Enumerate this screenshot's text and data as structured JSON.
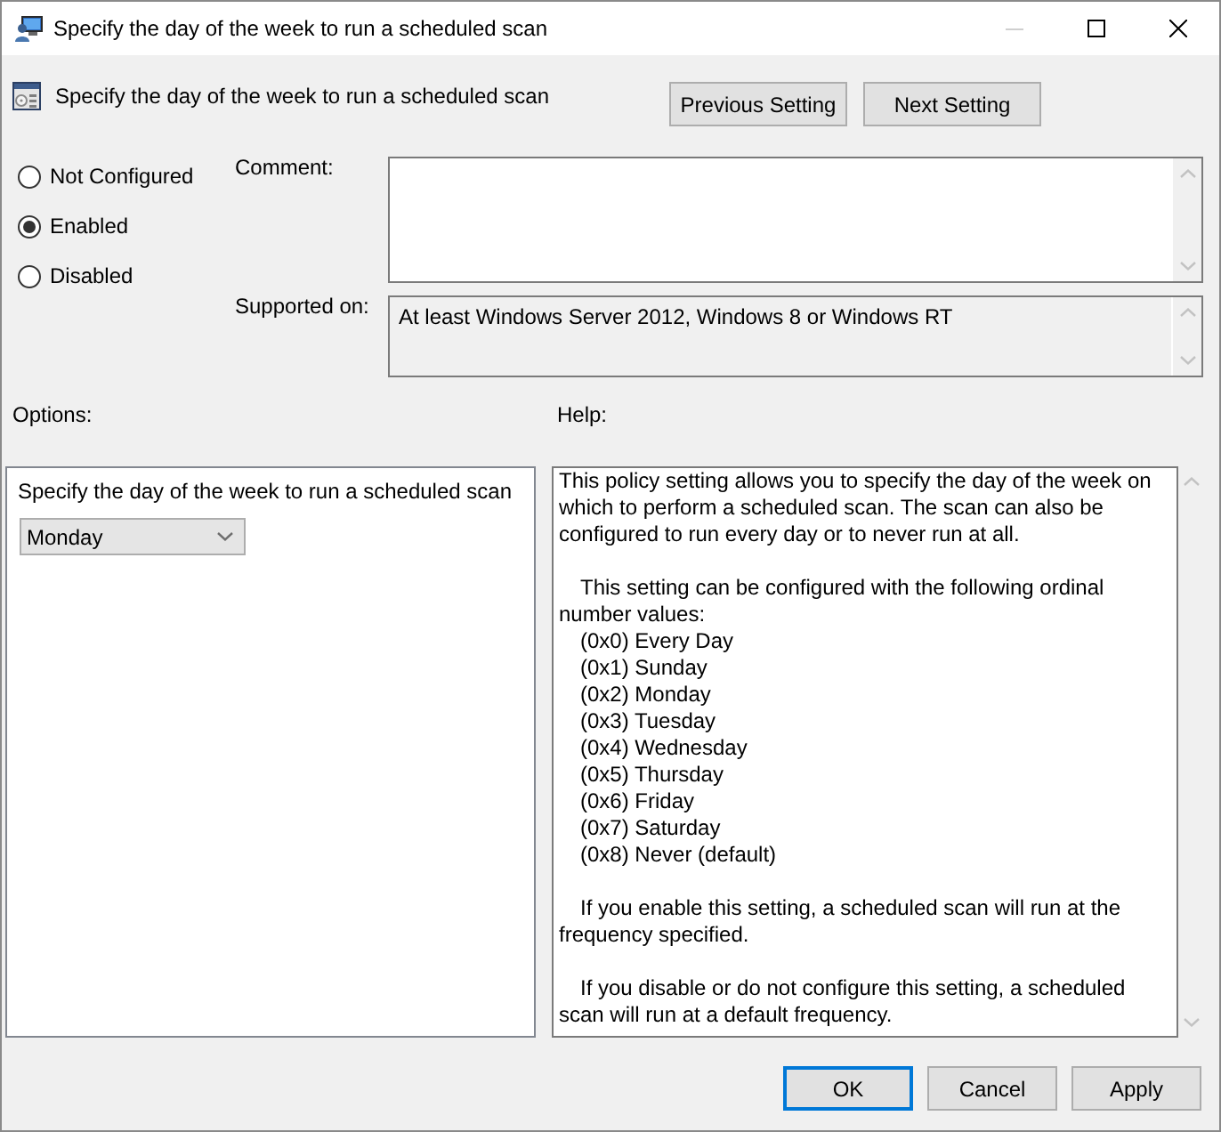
{
  "window": {
    "title": "Specify the day of the week to run a scheduled scan",
    "minimize_disabled": true
  },
  "header": {
    "title": "Specify the day of the week to run a scheduled scan",
    "buttons": [
      "Previous Setting",
      "Next Setting"
    ]
  },
  "state_options": [
    {
      "label": "Not Configured",
      "selected": false
    },
    {
      "label": "Enabled",
      "selected": true
    },
    {
      "label": "Disabled",
      "selected": false
    }
  ],
  "comment": {
    "label": "Comment:"
  },
  "supported_on": {
    "label": "Supported on:",
    "value": "At least Windows Server 2012, Windows 8 or Windows RT"
  },
  "options": {
    "label": "Options:",
    "items": [
      {
        "kind": "text",
        "text": "Specify the day of the week to run a scheduled scan"
      },
      {
        "kind": "dropdown",
        "value": "Monday"
      }
    ]
  },
  "help": {
    "label": "Help:",
    "blocks": [
      {
        "kind": "paragraph",
        "text": "This policy setting allows you to specify the day of the week on which to perform a scheduled scan. The scan can also be configured to run every day or to never run at all."
      },
      {
        "kind": "paragraph",
        "text": "This setting can be configured with the following ordinal number values:"
      },
      {
        "kind": "value",
        "text": "(0x0) Every Day"
      },
      {
        "kind": "value",
        "text": "(0x1) Sunday"
      },
      {
        "kind": "value",
        "text": "(0x2) Monday"
      },
      {
        "kind": "value",
        "text": "(0x3) Tuesday"
      },
      {
        "kind": "value",
        "text": "(0x4) Wednesday"
      },
      {
        "kind": "value",
        "text": "(0x5) Thursday"
      },
      {
        "kind": "value",
        "text": "(0x6) Friday"
      },
      {
        "kind": "value",
        "text": "(0x7) Saturday"
      },
      {
        "kind": "value",
        "text": "(0x8) Never (default)"
      },
      {
        "kind": "paragraph",
        "text": "If you enable this setting, a scheduled scan will run at the frequency specified."
      },
      {
        "kind": "paragraph",
        "text": "If you disable or do not configure this setting, a scheduled scan will run at a default frequency."
      }
    ]
  },
  "buttons": [
    {
      "label": "OK",
      "focused": true
    },
    {
      "label": "Cancel",
      "focused": false
    },
    {
      "label": "Apply",
      "focused": false
    }
  ]
}
